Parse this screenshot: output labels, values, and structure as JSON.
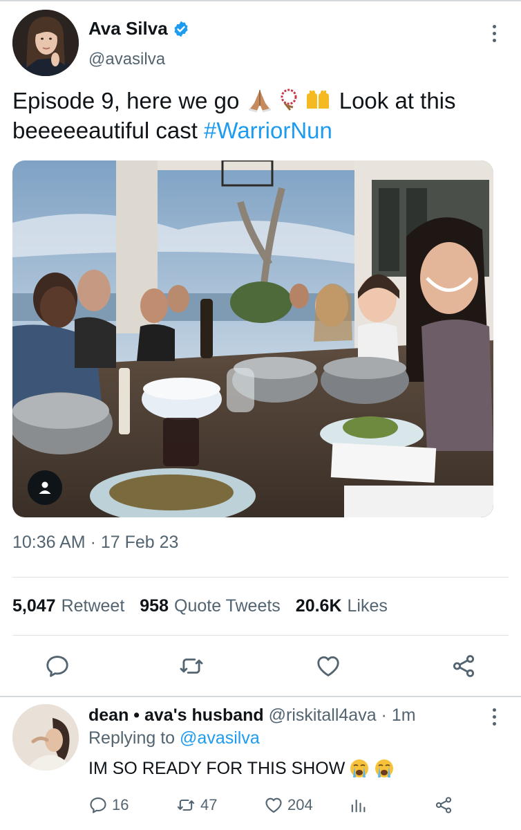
{
  "tweet": {
    "author": {
      "display_name": "Ava Silva",
      "handle": "@avasilva",
      "verified": true
    },
    "text_before_emoji": "Episode 9, here we go ",
    "emojis": [
      "folded-hands",
      "rosary-beads",
      "raised-hands"
    ],
    "text_after_emoji": " Look at this beeeeeautiful cast ",
    "hashtag": "#WarriorNun",
    "timestamp": "10:36 AM · 17 Feb 23",
    "stats": {
      "retweets": "5,047",
      "retweets_label": "Retweet",
      "quotes": "958",
      "quotes_label": "Quote Tweets",
      "likes": "20.6K",
      "likes_label": "Likes"
    },
    "actions": [
      "reply-icon",
      "retweet-icon",
      "like-icon",
      "share-icon"
    ]
  },
  "reply": {
    "display_name": "dean • ava's husband",
    "handle": "@riskitall4ava",
    "separator": " · ",
    "time": "1m",
    "replying_prefix": "Replying to ",
    "replying_handle": "@avasilva",
    "text": "IM SO READY FOR THIS SHOW",
    "emojis": [
      "loudly-crying-face",
      "loudly-crying-face"
    ],
    "reply_count": "16",
    "retweet_count": "47",
    "like_count": "204"
  },
  "colors": {
    "accent": "#1d9bf0",
    "text": "#0f1419",
    "secondary": "#536471"
  }
}
